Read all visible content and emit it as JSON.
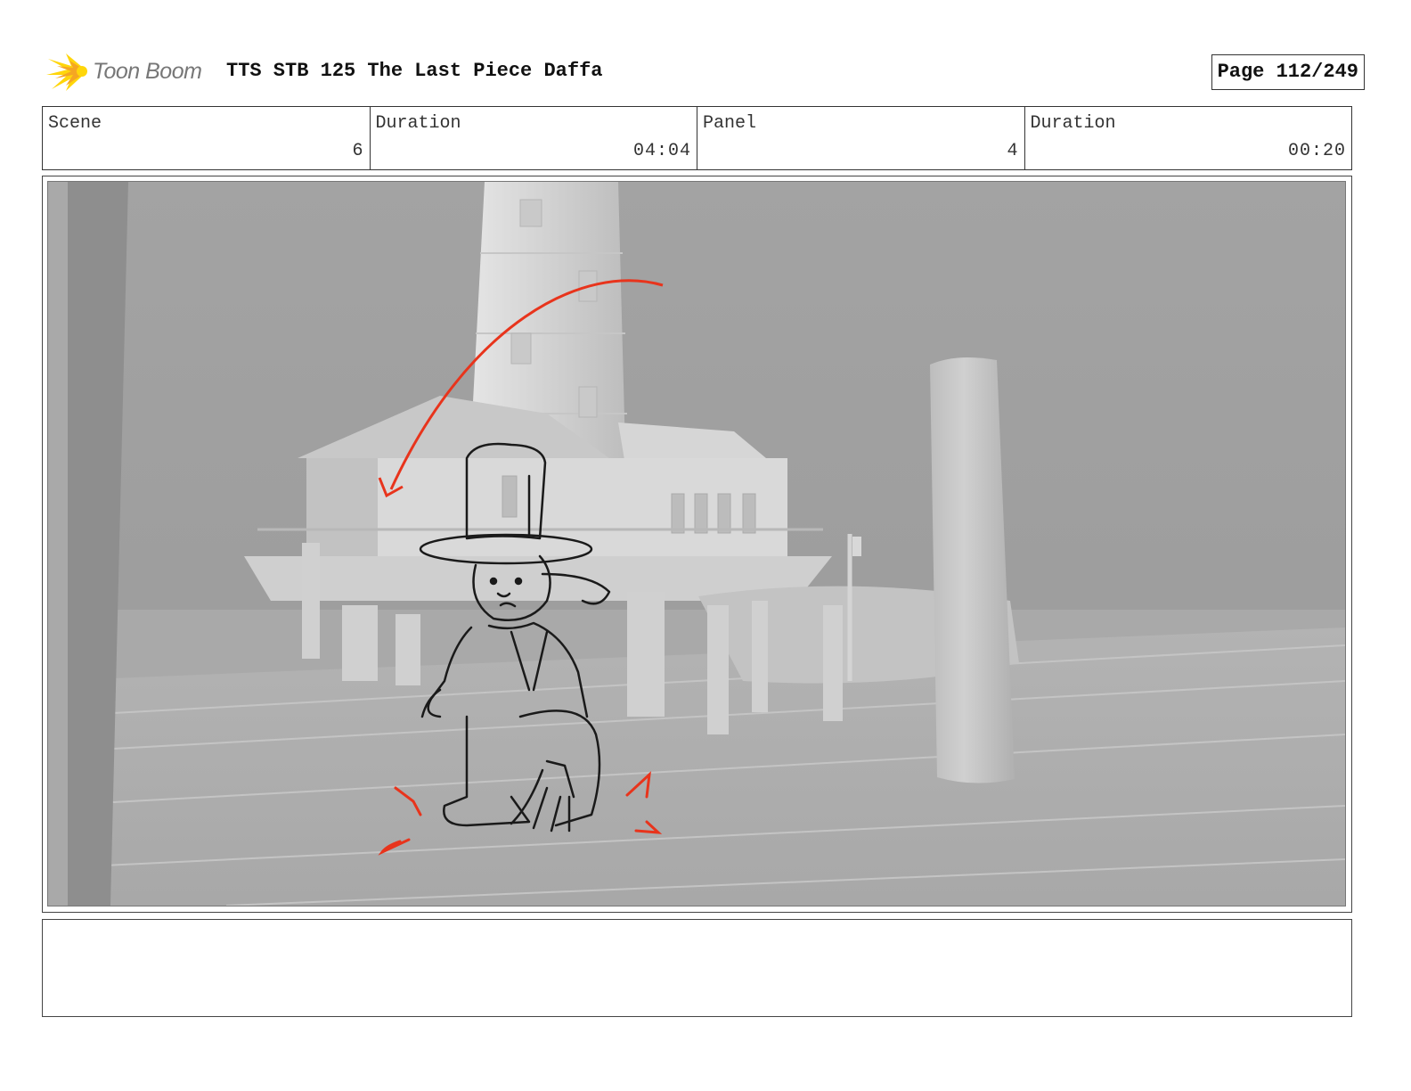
{
  "header": {
    "logo_text": "Toon Boom",
    "title": "TTS STB 125 The Last Piece Daffa",
    "page": "Page 112/249"
  },
  "info": {
    "scene_label": "Scene",
    "scene_value": "6",
    "scene_duration_label": "Duration",
    "scene_duration_value": "04:04",
    "panel_label": "Panel",
    "panel_value": "4",
    "panel_duration_label": "Duration",
    "panel_duration_value": "00:20"
  },
  "panel": {
    "image_icon": "storyboard-sketch-lighthouse-dock",
    "background_gray": "#9e9e9e",
    "sketch_color": "#1a1a1a",
    "action_color": "#e8341c"
  },
  "notes": {
    "text": ""
  },
  "colors": {
    "logo_orange": "#f5a623",
    "logo_yellow": "#ffd60a",
    "border": "#333333"
  }
}
